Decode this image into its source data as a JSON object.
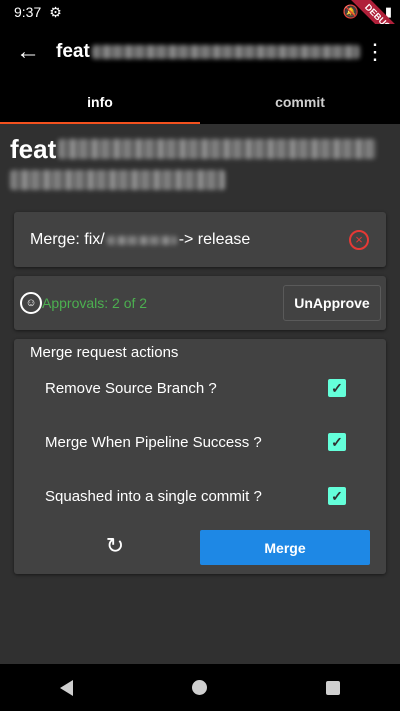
{
  "status_bar": {
    "time": "9:37",
    "debug_label": "DEBUG"
  },
  "app_bar": {
    "title": "feat",
    "back_icon": "arrow-left-icon",
    "menu_icon": "more-vert-icon"
  },
  "tabs": [
    {
      "label": "info",
      "active": true
    },
    {
      "label": "commit",
      "active": false
    }
  ],
  "content": {
    "title": "feat"
  },
  "merge_card": {
    "prefix": "Merge: fix/",
    "suffix": "-> release",
    "close_icon": "close-circle-icon"
  },
  "approval_card": {
    "approvals_text": "Approvals: 2 of 2",
    "unapprove_label": "UnApprove"
  },
  "actions_card": {
    "title": "Merge request actions",
    "options": [
      {
        "label": "Remove Source Branch ?",
        "checked": true
      },
      {
        "label": "Merge When Pipeline Success ?",
        "checked": true
      },
      {
        "label": "Squashed into a single commit ?",
        "checked": true
      }
    ],
    "merge_label": "Merge"
  },
  "colors": {
    "accent_tab": "#f4511e",
    "approvals_green": "#4caf50",
    "checkbox_teal": "#64ffda",
    "merge_blue": "#1e88e5",
    "close_red": "#e53935"
  }
}
